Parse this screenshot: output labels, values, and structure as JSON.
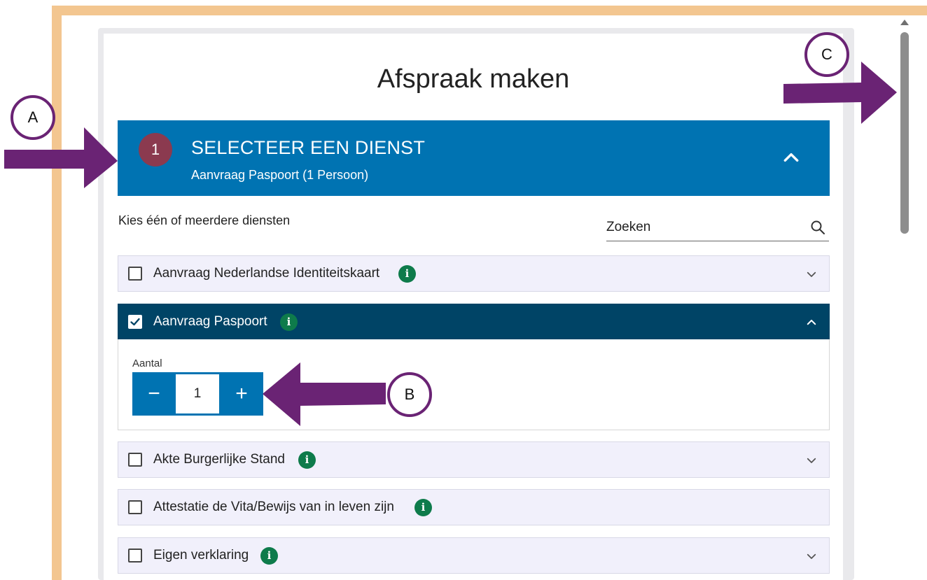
{
  "page": {
    "title": "Afspraak maken"
  },
  "step": {
    "number": "1",
    "title": "SELECTEER EEN DIENST",
    "subtitle": "Aanvraag Paspoort (1 Persoon)"
  },
  "intro": "Kies één of meerdere diensten",
  "search": {
    "placeholder": "Zoeken",
    "value": ""
  },
  "services": [
    {
      "label": "Aanvraag Nederlandse Identiteitskaart",
      "checked": false,
      "expandable": true
    },
    {
      "label": "Aanvraag Paspoort",
      "checked": true,
      "expandable": true,
      "expanded": true
    },
    {
      "label": "Akte Burgerlijke Stand",
      "checked": false,
      "expandable": true
    },
    {
      "label": "Attestatie de Vita/Bewijs van in leven zijn",
      "checked": false,
      "expandable": false
    },
    {
      "label": "Eigen verklaring",
      "checked": false,
      "expandable": true
    }
  ],
  "quantity": {
    "label": "Aantal",
    "value": "1",
    "minus": "−",
    "plus": "+"
  },
  "annotations": {
    "a": "A",
    "b": "B",
    "c": "C"
  },
  "colors": {
    "frame": "#f3c690",
    "header": "#0073b2",
    "selected_row": "#004466",
    "step_badge": "#8b3a4f",
    "info": "#0e7b4b",
    "annotation": "#6a2374"
  }
}
